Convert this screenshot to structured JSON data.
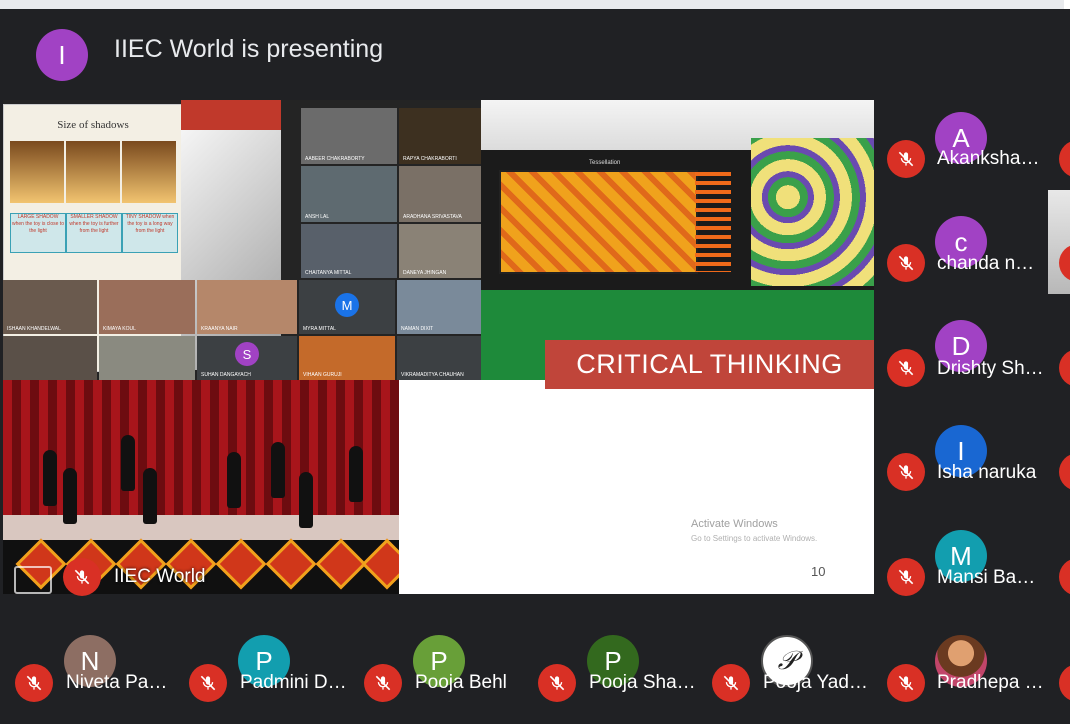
{
  "presenter": {
    "initial": "I",
    "text": "IIEC World is presenting",
    "avatar_color": "#a142c4"
  },
  "slide": {
    "shadows_title": "Size of shadows",
    "shadow_boxes": [
      "LARGE SHADOW when the toy is close to the light",
      "SMALLER SHADOW when the toy is further from the light",
      "TINY SHADOW when the toy is a long way from the light"
    ],
    "tiles": [
      {
        "name": "AABEER CHAKRABORTY"
      },
      {
        "name": "RAPYA CHAKRABORTI"
      },
      {
        "name": "ANSH LAL"
      },
      {
        "name": "ARADHANA SRIVASTAVA"
      },
      {
        "name": "CHAITANYA MITTAL"
      },
      {
        "name": "DANEYA JHINGAN"
      },
      {
        "name": "ISHAAN KHANDELWAL"
      },
      {
        "name": "KIMAYA KOUL"
      },
      {
        "name": "KRAANYA NAIR"
      },
      {
        "name": "MYRA MITTAL",
        "initial": "M",
        "color": "#1a73e8"
      },
      {
        "name": "NAMAN DIXIT"
      },
      {
        "name": ""
      },
      {
        "name": ""
      },
      {
        "name": "SUHAN DANGAYACH",
        "initial": "S",
        "color": "#a142c4"
      },
      {
        "name": "VIHAAN GURUJI"
      },
      {
        "name": "VIKRAMADITYA CHAUHAN"
      }
    ],
    "gallery_label": "Tessellation",
    "banner": "CRITICAL THINKING",
    "activate_line1": "Activate Windows",
    "activate_line2": "Go to Settings to activate Windows.",
    "page_number": "10"
  },
  "owner": {
    "name": "IIEC World",
    "mic_state": "muted"
  },
  "side_participants": [
    {
      "initial": "A",
      "name": "Akanksha…",
      "color": "#a142c4"
    },
    {
      "initial": "c",
      "name": "chanda n…",
      "color": "#a142c4"
    },
    {
      "initial": "D",
      "name": "Drishty Sh…",
      "color": "#a142c4"
    },
    {
      "initial": "I",
      "name": "Isha naruka",
      "color": "#1967d2"
    },
    {
      "initial": "M",
      "name": "Mansi Ba…",
      "color": "#129eaf"
    }
  ],
  "bottom_participants": [
    {
      "initial": "N",
      "name": "Niveta Pa…",
      "color": "#8d6e63"
    },
    {
      "initial": "P",
      "name": "Padmini D…",
      "color": "#129eaf"
    },
    {
      "initial": "P",
      "name": "Pooja Behl",
      "color": "#689f38"
    },
    {
      "initial": "P",
      "name": "Pooja Sha…",
      "color": "#33691e"
    },
    {
      "initial": "P",
      "name": "Pooja Yad…",
      "color": "#ffffff",
      "logo": true
    },
    {
      "initial": "",
      "name": "Pradhepa …",
      "color": "#c98a50",
      "photo": true
    }
  ]
}
